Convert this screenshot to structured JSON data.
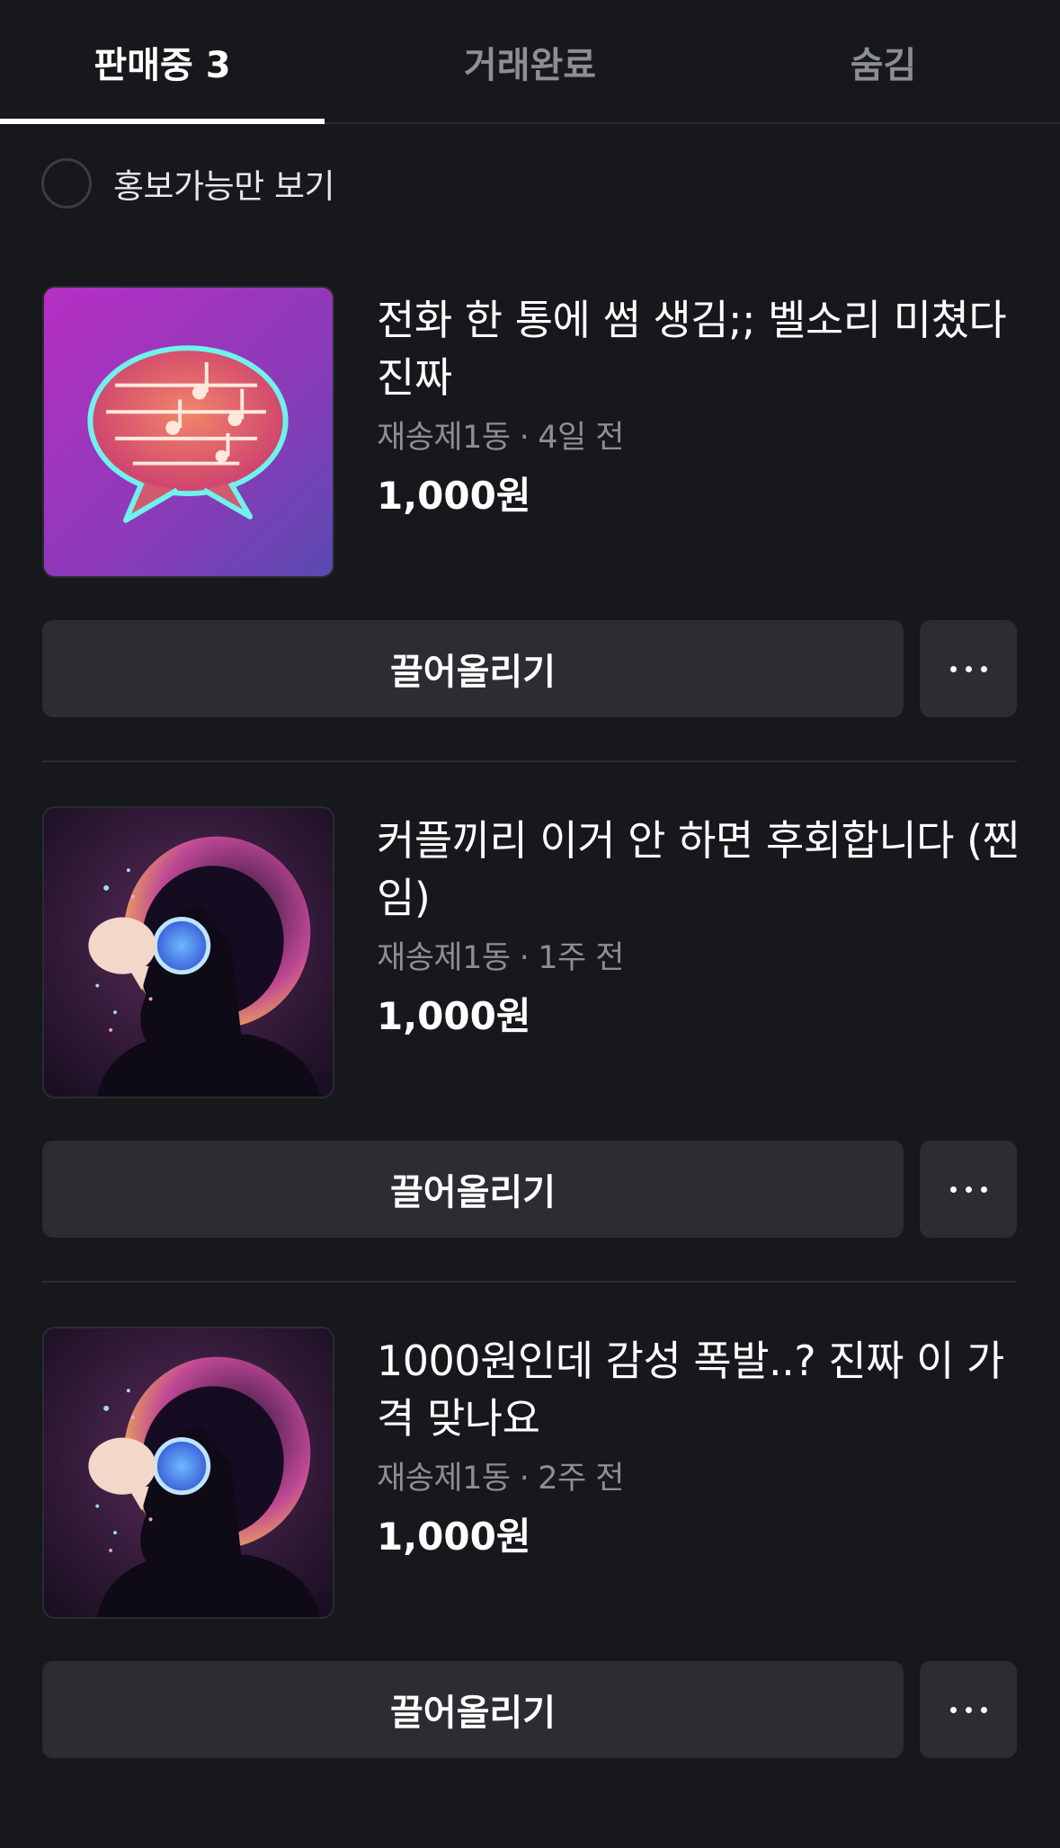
{
  "tabs": [
    {
      "label": "판매중 3",
      "active": true
    },
    {
      "label": "거래완료",
      "active": false
    },
    {
      "label": "숨김",
      "active": false
    }
  ],
  "filter": {
    "label": "홍보가능만 보기",
    "checked": false
  },
  "items": [
    {
      "title": "전화 한 통에 썸 생김;; 벨소리 미쳤다 진짜",
      "location": "재송제1동",
      "separator": "·",
      "time": "4일 전",
      "price": "1,000원",
      "thumbnail_icon": "neon-speech-bubble-music-notes-icon",
      "bump_label": "끌어올리기",
      "more_icon": "more-horizontal-icon"
    },
    {
      "title": "커플끼리 이거 안 하면 후회합니다 (찐임)",
      "location": "재송제1동",
      "separator": "·",
      "time": "1주 전",
      "price": "1,000원",
      "thumbnail_icon": "profile-silhouette-speech-bubble-icon",
      "bump_label": "끌어올리기",
      "more_icon": "more-horizontal-icon"
    },
    {
      "title": "1000원인데 감성 폭발..? 진짜 이 가격 맞나요",
      "location": "재송제1동",
      "separator": "·",
      "time": "2주 전",
      "price": "1,000원",
      "thumbnail_icon": "profile-silhouette-speech-bubble-icon",
      "bump_label": "끌어올리기",
      "more_icon": "more-horizontal-icon"
    }
  ],
  "colors": {
    "background": "#17181c",
    "button_bg": "#2b2d32",
    "muted_text": "#8b8e95",
    "text": "#ffffff"
  }
}
